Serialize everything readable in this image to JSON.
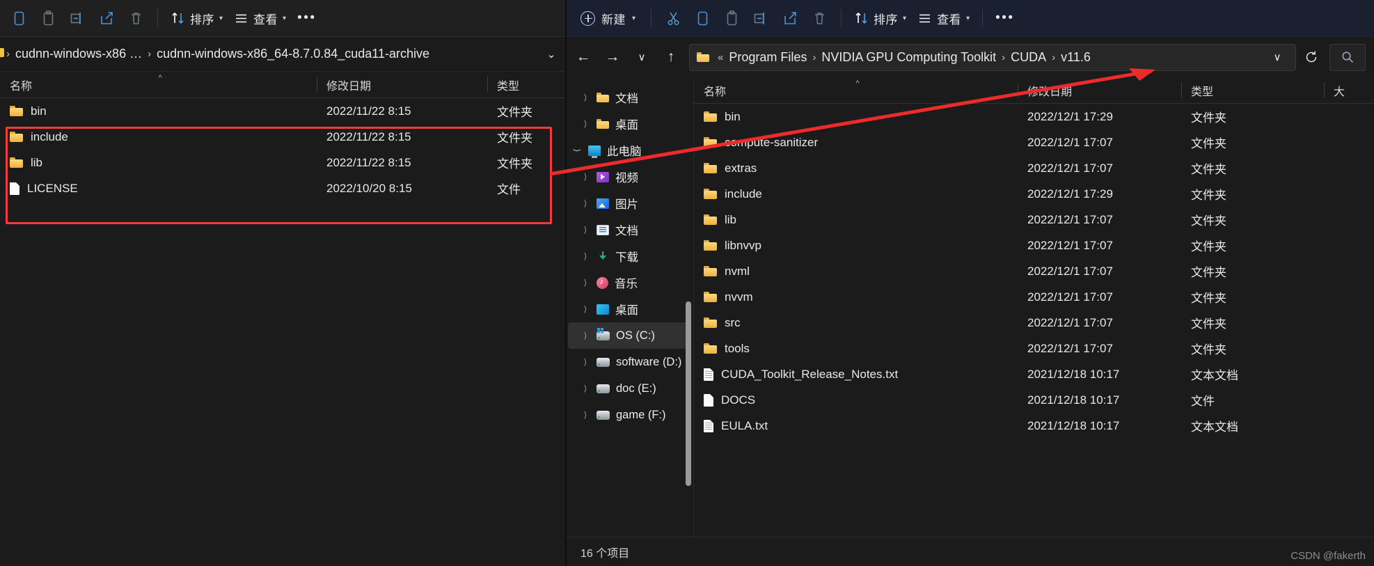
{
  "left_window": {
    "toolbar": {
      "icons": [
        {
          "name": "copy-icon",
          "glyph": "❐"
        },
        {
          "name": "paste-icon",
          "glyph": "ὌB"
        },
        {
          "name": "rename-icon",
          "glyph": "⫭"
        },
        {
          "name": "share-icon",
          "glyph": "↪"
        },
        {
          "name": "delete-icon",
          "glyph": "🗑"
        }
      ],
      "sort_label": "排序",
      "view_label": "查看",
      "more_label": "•••"
    },
    "breadcrumb": [
      "cudnn-windows-x86 …",
      "cudnn-windows-x86_64-8.7.0.84_cuda11-archive"
    ],
    "columns": [
      "名称",
      "修改日期",
      "类型"
    ],
    "rows": [
      {
        "icon": "folder",
        "name": "bin",
        "date": "2022/11/22 8:15",
        "type": "文件夹"
      },
      {
        "icon": "folder",
        "name": "include",
        "date": "2022/11/22 8:15",
        "type": "文件夹"
      },
      {
        "icon": "folder",
        "name": "lib",
        "date": "2022/11/22 8:15",
        "type": "文件夹"
      },
      {
        "icon": "file",
        "name": "LICENSE",
        "date": "2022/10/20 8:15",
        "type": "文件"
      }
    ]
  },
  "right_window": {
    "toolbar": {
      "new_label": "新建",
      "icons": [
        {
          "name": "cut-icon",
          "glyph": "✂"
        },
        {
          "name": "copy-icon",
          "glyph": "❐"
        },
        {
          "name": "paste-icon",
          "glyph": "📋"
        },
        {
          "name": "rename-icon",
          "glyph": "⫭"
        },
        {
          "name": "share-icon",
          "glyph": "↪"
        },
        {
          "name": "delete-icon",
          "glyph": "🗑"
        }
      ],
      "sort_label": "排序",
      "view_label": "查看",
      "more_label": "•••"
    },
    "address": {
      "prefix": "«",
      "breadcrumb": [
        "Program Files",
        "NVIDIA GPU Computing Toolkit",
        "CUDA",
        "v11.6"
      ],
      "back_icon": "←",
      "forward_icon": "→",
      "recent_icon": "∨",
      "up_icon": "↑",
      "dropdown_icon": "∨",
      "refresh_icon": "↻",
      "search_icon": "⌕"
    },
    "nav_tree": [
      {
        "icon": "folder",
        "label": "文档",
        "indent": 1,
        "expanded": false,
        "selected": false
      },
      {
        "icon": "folder",
        "label": "桌面",
        "indent": 1,
        "expanded": false,
        "selected": false
      },
      {
        "icon": "pc",
        "label": "此电脑",
        "indent": 0,
        "expanded": true,
        "selected": false
      },
      {
        "icon": "video",
        "label": "视频",
        "indent": 1,
        "expanded": false,
        "selected": false
      },
      {
        "icon": "picture",
        "label": "图片",
        "indent": 1,
        "expanded": false,
        "selected": false
      },
      {
        "icon": "document",
        "label": "文档",
        "indent": 1,
        "expanded": false,
        "selected": false
      },
      {
        "icon": "download",
        "label": "下载",
        "indent": 1,
        "expanded": false,
        "selected": false
      },
      {
        "icon": "music",
        "label": "音乐",
        "indent": 1,
        "expanded": false,
        "selected": false
      },
      {
        "icon": "desktop",
        "label": "桌面",
        "indent": 1,
        "expanded": false,
        "selected": false
      },
      {
        "icon": "drive-os",
        "label": "OS (C:)",
        "indent": 1,
        "expanded": false,
        "selected": true
      },
      {
        "icon": "drive",
        "label": "software (D:)",
        "indent": 1,
        "expanded": false,
        "selected": false
      },
      {
        "icon": "drive",
        "label": "doc (E:)",
        "indent": 1,
        "expanded": false,
        "selected": false
      },
      {
        "icon": "drive",
        "label": "game (F:)",
        "indent": 1,
        "expanded": false,
        "selected": false
      }
    ],
    "columns": [
      "名称",
      "修改日期",
      "类型",
      "大"
    ],
    "rows": [
      {
        "icon": "folder",
        "name": "bin",
        "date": "2022/12/1 17:29",
        "type": "文件夹"
      },
      {
        "icon": "folder",
        "name": "compute-sanitizer",
        "date": "2022/12/1 17:07",
        "type": "文件夹"
      },
      {
        "icon": "folder",
        "name": "extras",
        "date": "2022/12/1 17:07",
        "type": "文件夹"
      },
      {
        "icon": "folder",
        "name": "include",
        "date": "2022/12/1 17:29",
        "type": "文件夹"
      },
      {
        "icon": "folder",
        "name": "lib",
        "date": "2022/12/1 17:07",
        "type": "文件夹"
      },
      {
        "icon": "folder",
        "name": "libnvvp",
        "date": "2022/12/1 17:07",
        "type": "文件夹"
      },
      {
        "icon": "folder",
        "name": "nvml",
        "date": "2022/12/1 17:07",
        "type": "文件夹"
      },
      {
        "icon": "folder",
        "name": "nvvm",
        "date": "2022/12/1 17:07",
        "type": "文件夹"
      },
      {
        "icon": "folder",
        "name": "src",
        "date": "2022/12/1 17:07",
        "type": "文件夹"
      },
      {
        "icon": "folder",
        "name": "tools",
        "date": "2022/12/1 17:07",
        "type": "文件夹"
      },
      {
        "icon": "file-txt",
        "name": "CUDA_Toolkit_Release_Notes.txt",
        "date": "2021/12/18 10:17",
        "type": "文本文档"
      },
      {
        "icon": "file",
        "name": "DOCS",
        "date": "2021/12/18 10:17",
        "type": "文件"
      },
      {
        "icon": "file-txt",
        "name": "EULA.txt",
        "date": "2021/12/18 10:17",
        "type": "文本文档"
      }
    ],
    "status": "16 个项目"
  },
  "annotation": {
    "highlight_color": "#f23b3b",
    "arrow_color": "#ee2b2b"
  },
  "watermark": "CSDN @fakerth"
}
